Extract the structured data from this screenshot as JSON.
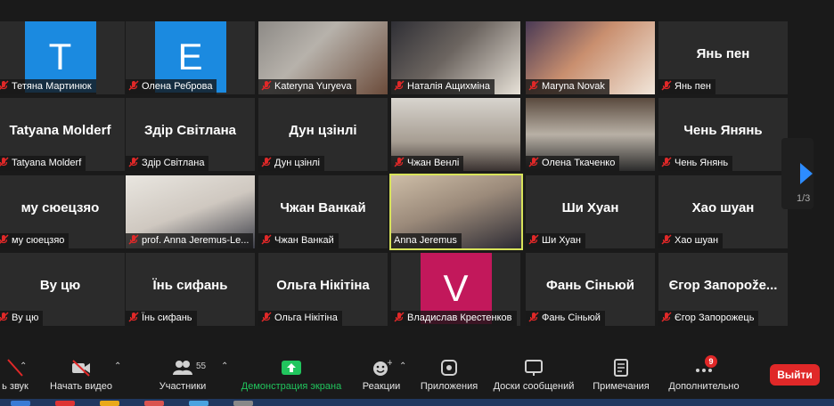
{
  "participants": [
    {
      "name": "Тетяна Мартинюк",
      "avatar_letter": "T",
      "avatar_color": "#1b8ae0"
    },
    {
      "name": "Олена Реброва",
      "avatar_letter": "E",
      "avatar_color": "#1b8ae0"
    },
    {
      "name": "Kateryna Yuryeva"
    },
    {
      "name": "Наталія Ащихміна"
    },
    {
      "name": "Maryna Novak"
    },
    {
      "name": "Янь пен",
      "display": "Янь пен"
    },
    {
      "name": "Tatyana Molderf",
      "display": "Tatyana Molderf"
    },
    {
      "name": "Здір Світлана",
      "display": "Здір Світлана"
    },
    {
      "name": "Дун цзінлі",
      "display": "Дун цзінлі"
    },
    {
      "name": "Чжан Венлі"
    },
    {
      "name": "Олена Ткаченко"
    },
    {
      "name": "Чень Янянь",
      "display": "Чень Янянь"
    },
    {
      "name": "му сюецзяо",
      "display": "му сюецзяо"
    },
    {
      "name": "prof. Anna Jeremus-Le..."
    },
    {
      "name": "Чжан Ванкай",
      "display": "Чжан Ванкай"
    },
    {
      "name": "Anna Jeremus"
    },
    {
      "name": "Ши Хуан",
      "display": "Ши Хуан"
    },
    {
      "name": "Хао шуан",
      "display": "Хао шуан"
    },
    {
      "name": "Ву цю",
      "display": "Ву цю"
    },
    {
      "name": "Їнь сифань",
      "display": "Їнь сифань"
    },
    {
      "name": "Ольга Нікітіна",
      "display": "Ольга Нікітіна"
    },
    {
      "name": "Владислав Крестенков",
      "avatar_letter": "V",
      "avatar_color": "#c2185b"
    },
    {
      "name": "Фань Сіньюй",
      "display": "Фань Сіньюй"
    },
    {
      "name": "Єгор Запорожець",
      "display": "Єгор Запорože..."
    }
  ],
  "pagination": {
    "indicator": "1/3"
  },
  "toolbar": {
    "audio_label": "ь звук",
    "video_label": "Начать видео",
    "participants_label": "Участники",
    "participants_count": "55",
    "share_label": "Демонстрация экрана",
    "reactions_label": "Реакции",
    "apps_label": "Приложения",
    "whiteboards_label": "Доски сообщений",
    "notes_label": "Примечания",
    "more_label": "Дополнительно",
    "more_badge": "9",
    "leave_label": "Выйти"
  },
  "colors": {
    "active_speaker": "#d8e35a",
    "share_green": "#21c55d",
    "leave_red": "#e02828",
    "muted_red": "#e02828"
  }
}
